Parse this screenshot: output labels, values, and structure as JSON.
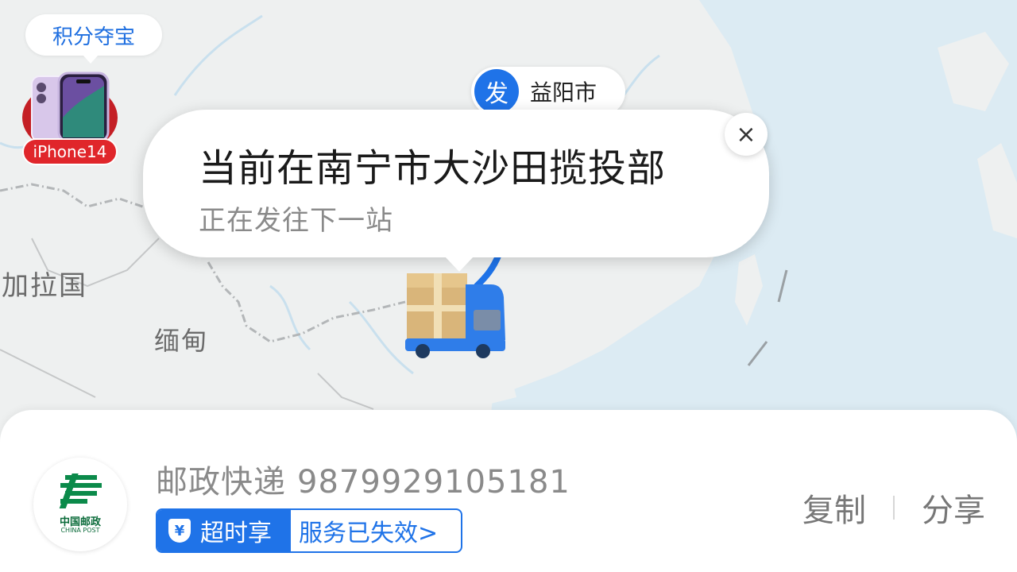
{
  "map": {
    "labels": {
      "bangladesh": "加拉国",
      "myanmar": "缅甸"
    }
  },
  "promo": {
    "points_label": "积分夺宝",
    "prize_label": "iPhone14"
  },
  "origin": {
    "badge": "发",
    "city": "益阳市"
  },
  "status": {
    "title": "当前在南宁市大沙田揽投部",
    "subtitle": "正在发往下一站",
    "close_symbol": "×"
  },
  "shipment": {
    "carrier_name": "邮政快递",
    "tracking_number": "9879929105181",
    "logo_cn": "中国邮政",
    "logo_en": "CHINA POST",
    "service_shield": "¥",
    "service_name": "超时享",
    "service_status": "服务已失效>",
    "actions": {
      "copy": "复制",
      "share": "分享"
    }
  },
  "colors": {
    "accent": "#1f73e8",
    "water": "#dcebf3",
    "land": "#eef0f0",
    "promo_red": "#e0262b",
    "post_green": "#0b6b3a"
  }
}
